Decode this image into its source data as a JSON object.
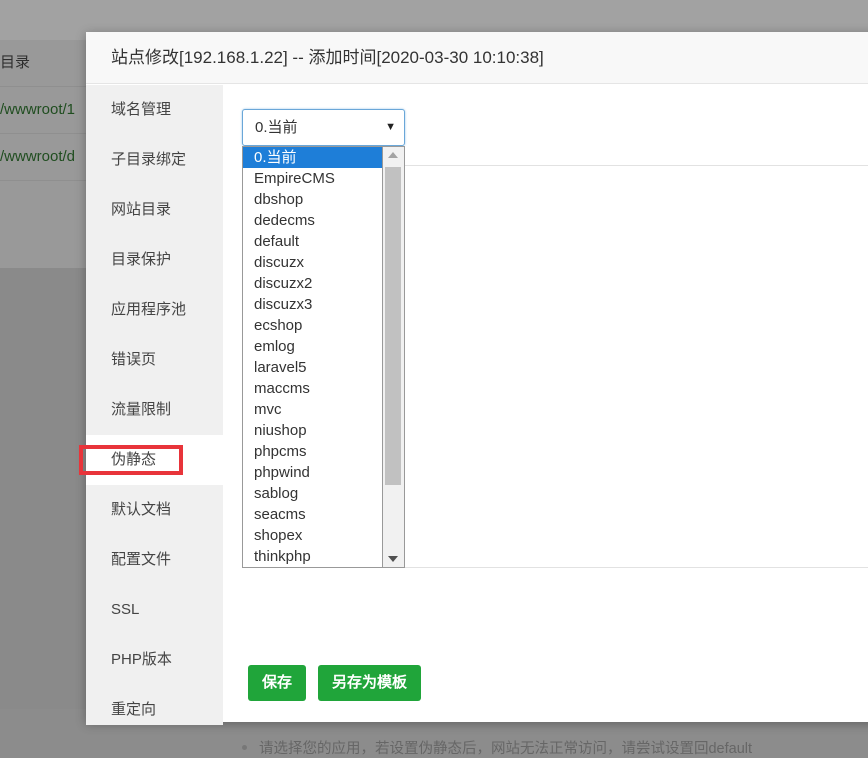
{
  "background": {
    "header_label": "目录",
    "rows": [
      "/wwwroot/1",
      "/wwwroot/d"
    ]
  },
  "dialog": {
    "title": "站点修改[192.168.1.22] -- 添加时间[2020-03-30 10:10:38]"
  },
  "sidebar": {
    "items": [
      {
        "label": "域名管理"
      },
      {
        "label": "子目录绑定"
      },
      {
        "label": "网站目录"
      },
      {
        "label": "目录保护"
      },
      {
        "label": "应用程序池"
      },
      {
        "label": "错误页"
      },
      {
        "label": "流量限制"
      },
      {
        "label": "伪静态"
      },
      {
        "label": "默认文档"
      },
      {
        "label": "配置文件"
      },
      {
        "label": "SSL"
      },
      {
        "label": "PHP版本"
      },
      {
        "label": "重定向"
      }
    ],
    "active": "伪静态"
  },
  "rewrite_select": {
    "selected": "0.当前",
    "options": [
      "0.当前",
      "EmpireCMS",
      "dbshop",
      "dedecms",
      "default",
      "discuzx",
      "discuzx2",
      "discuzx3",
      "ecshop",
      "emlog",
      "laravel5",
      "maccms",
      "mvc",
      "niushop",
      "phpcms",
      "phpwind",
      "sablog",
      "seacms",
      "shopex",
      "thinkphp"
    ]
  },
  "buttons": {
    "save": "保存",
    "save_as_template": "另存为模板"
  },
  "tip": "请选择您的应用，若设置伪静态后，网站无法正常访问，请尝试设置回default",
  "colors": {
    "accent_green": "#20a53a",
    "selected_blue": "#1e7ed8",
    "highlight_red": "#e8343a"
  }
}
